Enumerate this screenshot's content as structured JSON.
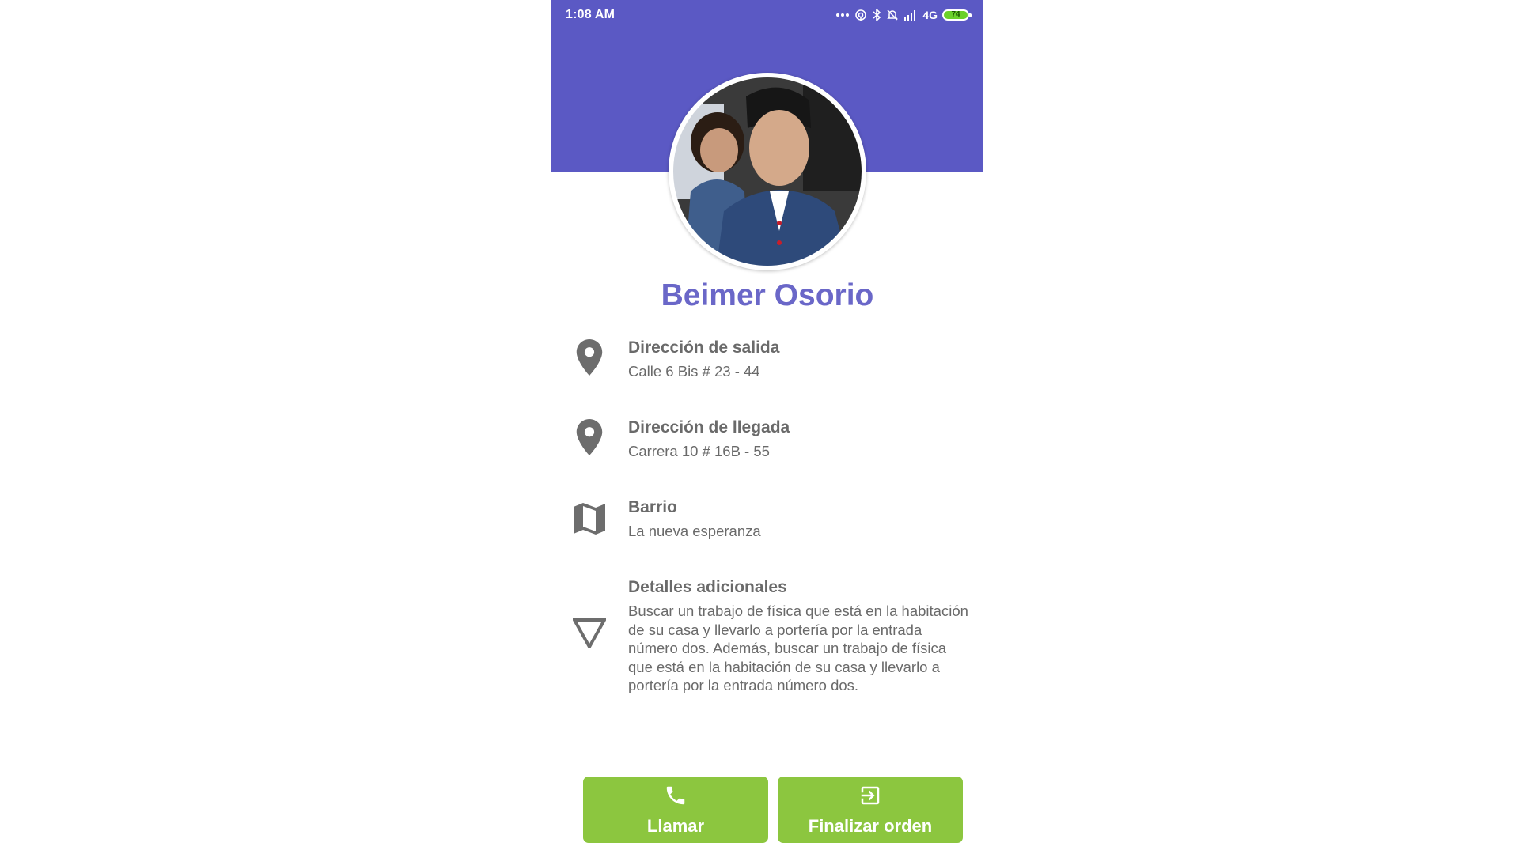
{
  "status_bar": {
    "time": "1:08 AM",
    "network": "4G",
    "battery": "74"
  },
  "profile": {
    "name": "Beimer Osorio",
    "avatar_icon": "profile-photo"
  },
  "details": [
    {
      "icon": "location-pin-icon",
      "title": "Dirección de salida",
      "value": "Calle 6 Bis # 23 - 44"
    },
    {
      "icon": "location-pin-icon",
      "title": "Dirección de llegada",
      "value": "Carrera 10 # 16B - 55"
    },
    {
      "icon": "map-icon",
      "title": "Barrio",
      "value": "La nueva esperanza"
    },
    {
      "icon": "triangle-down-icon",
      "title": "Detalles adicionales",
      "value": "Buscar un trabajo de física que está en la habitación de su casa y llevarlo a portería por la entrada número dos. Además, buscar un trabajo de física que está en la habitación de su casa y llevarlo a portería por la entrada número dos."
    }
  ],
  "actions": {
    "call_label": "Llamar",
    "finish_label": "Finalizar orden"
  },
  "colors": {
    "header": "#5b59c4",
    "name": "#6a67c8",
    "button": "#8cc63f",
    "text": "#6a6a6a"
  }
}
